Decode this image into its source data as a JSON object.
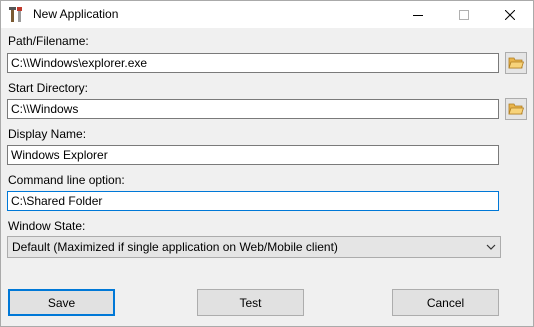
{
  "window": {
    "title": "New Application",
    "icon": "tools-icon",
    "controls": [
      "minimize-icon",
      "maximize-icon",
      "close-icon"
    ]
  },
  "form": {
    "path": {
      "label": "Path/Filename:",
      "value": "C:\\\\Windows\\explorer.exe",
      "button_icon": "folder-open-icon"
    },
    "start_dir": {
      "label": "Start Directory:",
      "value": "C:\\\\Windows",
      "button_icon": "folder-open-icon"
    },
    "display_name": {
      "label": "Display Name:",
      "value": "Windows Explorer"
    },
    "cmd_option": {
      "label": "Command line option:",
      "value": "C:\\Shared Folder"
    },
    "window_state": {
      "label": "Window State:",
      "selected": "Default (Maximized if single application on Web/Mobile client)"
    }
  },
  "buttons": {
    "save": "Save",
    "test": "Test",
    "cancel": "Cancel"
  },
  "colors": {
    "accent": "#0078d7",
    "dialog_bg": "#f0f0f0",
    "folder_icon": "#e8b44c"
  }
}
